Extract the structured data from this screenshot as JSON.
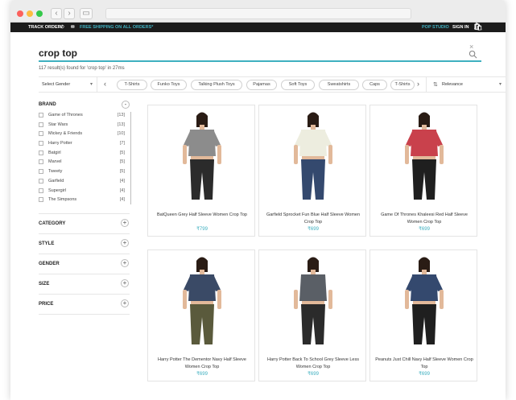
{
  "topbar": {
    "track_order": "TRACK ORDER",
    "free_shipping": "FREE SHIPPING ON ALL ORDERS*",
    "pop_studio": "POP STUDIO",
    "sign_in": "SIGN IN"
  },
  "search": {
    "query": "crop top",
    "close_glyph": "×",
    "results_info": "117 result(s) found for 'crop top' in 27ms"
  },
  "filterbar": {
    "gender_label": "Select Gender",
    "chips": [
      "T-Shirts",
      "Funko Toys",
      "Talking Plush Toys",
      "Pajamas",
      "Soft Toys",
      "Sweatshirts",
      "Caps",
      "T-Shirts"
    ],
    "sort_label": "Relevance"
  },
  "brand": {
    "title": "BRAND",
    "toggle": "-",
    "items": [
      {
        "name": "Game of Thrones",
        "count": "[13]"
      },
      {
        "name": "Star Wars",
        "count": "[13]"
      },
      {
        "name": "Mickey & Friends",
        "count": "[10]"
      },
      {
        "name": "Harry Potter",
        "count": "[7]"
      },
      {
        "name": "Batgirl",
        "count": "[5]"
      },
      {
        "name": "Marvel",
        "count": "[5]"
      },
      {
        "name": "Tweety",
        "count": "[5]"
      },
      {
        "name": "Garfield",
        "count": "[4]"
      },
      {
        "name": "Supergirl",
        "count": "[4]"
      },
      {
        "name": "The Simpsons",
        "count": "[4]"
      }
    ]
  },
  "facets": [
    "CATEGORY",
    "STYLE",
    "GENDER",
    "SIZE",
    "PRICE"
  ],
  "products": [
    {
      "name": "BatQueen Grey Half Sleeve Women Crop Top",
      "price": "₹799",
      "shirt_color": "#8c8c8c",
      "pant_color": "#2b2b2b"
    },
    {
      "name": "Garfield Sprocket Fun Blue Half Sleeve Women Crop Top",
      "price": "₹699",
      "shirt_color": "#ededdf",
      "pant_color": "#34496e"
    },
    {
      "name": "Game Of Thrones Khaleesi Red Half Sleeve Women Crop Top",
      "price": "₹699",
      "shirt_color": "#c9414c",
      "pant_color": "#1f1f1f"
    },
    {
      "name": "Harry Potter The Dementor Navy Half Sleeve Women Crop Top",
      "price": "₹699",
      "shirt_color": "#3a4a66",
      "pant_color": "#5a5a3c"
    },
    {
      "name": "Harry Potter Back To School Grey Sleeve Less Women Crop Top",
      "price": "₹699",
      "shirt_color": "#5a5f66",
      "pant_color": "#2b2b2b"
    },
    {
      "name": "Peanuts Just Chill Navy Half Sleeve Women Crop Top",
      "price": "₹699",
      "shirt_color": "#34496e",
      "pant_color": "#1f1f1f"
    }
  ]
}
